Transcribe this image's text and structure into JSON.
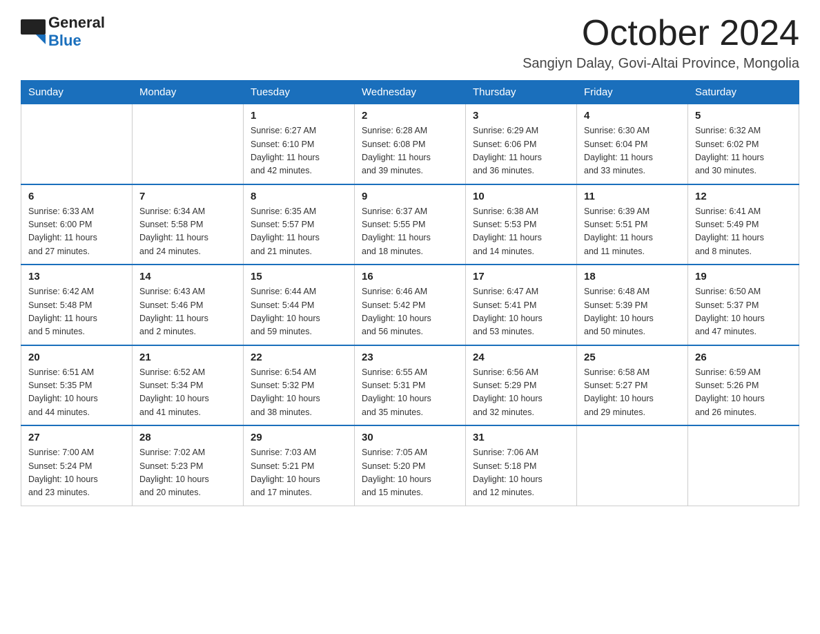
{
  "logo": {
    "general": "General",
    "blue": "Blue"
  },
  "title": "October 2024",
  "location": "Sangiyn Dalay, Govi-Altai Province, Mongolia",
  "days_of_week": [
    "Sunday",
    "Monday",
    "Tuesday",
    "Wednesday",
    "Thursday",
    "Friday",
    "Saturday"
  ],
  "weeks": [
    [
      {
        "day": "",
        "info": ""
      },
      {
        "day": "",
        "info": ""
      },
      {
        "day": "1",
        "info": "Sunrise: 6:27 AM\nSunset: 6:10 PM\nDaylight: 11 hours\nand 42 minutes."
      },
      {
        "day": "2",
        "info": "Sunrise: 6:28 AM\nSunset: 6:08 PM\nDaylight: 11 hours\nand 39 minutes."
      },
      {
        "day": "3",
        "info": "Sunrise: 6:29 AM\nSunset: 6:06 PM\nDaylight: 11 hours\nand 36 minutes."
      },
      {
        "day": "4",
        "info": "Sunrise: 6:30 AM\nSunset: 6:04 PM\nDaylight: 11 hours\nand 33 minutes."
      },
      {
        "day": "5",
        "info": "Sunrise: 6:32 AM\nSunset: 6:02 PM\nDaylight: 11 hours\nand 30 minutes."
      }
    ],
    [
      {
        "day": "6",
        "info": "Sunrise: 6:33 AM\nSunset: 6:00 PM\nDaylight: 11 hours\nand 27 minutes."
      },
      {
        "day": "7",
        "info": "Sunrise: 6:34 AM\nSunset: 5:58 PM\nDaylight: 11 hours\nand 24 minutes."
      },
      {
        "day": "8",
        "info": "Sunrise: 6:35 AM\nSunset: 5:57 PM\nDaylight: 11 hours\nand 21 minutes."
      },
      {
        "day": "9",
        "info": "Sunrise: 6:37 AM\nSunset: 5:55 PM\nDaylight: 11 hours\nand 18 minutes."
      },
      {
        "day": "10",
        "info": "Sunrise: 6:38 AM\nSunset: 5:53 PM\nDaylight: 11 hours\nand 14 minutes."
      },
      {
        "day": "11",
        "info": "Sunrise: 6:39 AM\nSunset: 5:51 PM\nDaylight: 11 hours\nand 11 minutes."
      },
      {
        "day": "12",
        "info": "Sunrise: 6:41 AM\nSunset: 5:49 PM\nDaylight: 11 hours\nand 8 minutes."
      }
    ],
    [
      {
        "day": "13",
        "info": "Sunrise: 6:42 AM\nSunset: 5:48 PM\nDaylight: 11 hours\nand 5 minutes."
      },
      {
        "day": "14",
        "info": "Sunrise: 6:43 AM\nSunset: 5:46 PM\nDaylight: 11 hours\nand 2 minutes."
      },
      {
        "day": "15",
        "info": "Sunrise: 6:44 AM\nSunset: 5:44 PM\nDaylight: 10 hours\nand 59 minutes."
      },
      {
        "day": "16",
        "info": "Sunrise: 6:46 AM\nSunset: 5:42 PM\nDaylight: 10 hours\nand 56 minutes."
      },
      {
        "day": "17",
        "info": "Sunrise: 6:47 AM\nSunset: 5:41 PM\nDaylight: 10 hours\nand 53 minutes."
      },
      {
        "day": "18",
        "info": "Sunrise: 6:48 AM\nSunset: 5:39 PM\nDaylight: 10 hours\nand 50 minutes."
      },
      {
        "day": "19",
        "info": "Sunrise: 6:50 AM\nSunset: 5:37 PM\nDaylight: 10 hours\nand 47 minutes."
      }
    ],
    [
      {
        "day": "20",
        "info": "Sunrise: 6:51 AM\nSunset: 5:35 PM\nDaylight: 10 hours\nand 44 minutes."
      },
      {
        "day": "21",
        "info": "Sunrise: 6:52 AM\nSunset: 5:34 PM\nDaylight: 10 hours\nand 41 minutes."
      },
      {
        "day": "22",
        "info": "Sunrise: 6:54 AM\nSunset: 5:32 PM\nDaylight: 10 hours\nand 38 minutes."
      },
      {
        "day": "23",
        "info": "Sunrise: 6:55 AM\nSunset: 5:31 PM\nDaylight: 10 hours\nand 35 minutes."
      },
      {
        "day": "24",
        "info": "Sunrise: 6:56 AM\nSunset: 5:29 PM\nDaylight: 10 hours\nand 32 minutes."
      },
      {
        "day": "25",
        "info": "Sunrise: 6:58 AM\nSunset: 5:27 PM\nDaylight: 10 hours\nand 29 minutes."
      },
      {
        "day": "26",
        "info": "Sunrise: 6:59 AM\nSunset: 5:26 PM\nDaylight: 10 hours\nand 26 minutes."
      }
    ],
    [
      {
        "day": "27",
        "info": "Sunrise: 7:00 AM\nSunset: 5:24 PM\nDaylight: 10 hours\nand 23 minutes."
      },
      {
        "day": "28",
        "info": "Sunrise: 7:02 AM\nSunset: 5:23 PM\nDaylight: 10 hours\nand 20 minutes."
      },
      {
        "day": "29",
        "info": "Sunrise: 7:03 AM\nSunset: 5:21 PM\nDaylight: 10 hours\nand 17 minutes."
      },
      {
        "day": "30",
        "info": "Sunrise: 7:05 AM\nSunset: 5:20 PM\nDaylight: 10 hours\nand 15 minutes."
      },
      {
        "day": "31",
        "info": "Sunrise: 7:06 AM\nSunset: 5:18 PM\nDaylight: 10 hours\nand 12 minutes."
      },
      {
        "day": "",
        "info": ""
      },
      {
        "day": "",
        "info": ""
      }
    ]
  ]
}
